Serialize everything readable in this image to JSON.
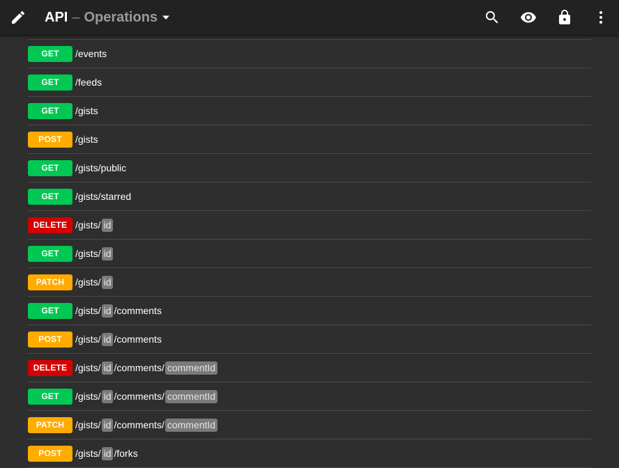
{
  "header": {
    "title_main": "API",
    "title_separator": "–",
    "title_section": "Operations",
    "icons": [
      "edit-icon",
      "search-icon",
      "visibility-icon",
      "lock-icon",
      "more-vert-icon"
    ]
  },
  "colors": {
    "GET": "#00c853",
    "POST": "#ffab00",
    "PATCH": "#ffab00",
    "DELETE": "#d50000"
  },
  "operations": [
    {
      "method": "GET",
      "parts": [
        {
          "t": "text",
          "v": "/"
        }
      ]
    },
    {
      "method": "GET",
      "parts": [
        {
          "t": "text",
          "v": "/events"
        }
      ]
    },
    {
      "method": "GET",
      "parts": [
        {
          "t": "text",
          "v": "/feeds"
        }
      ]
    },
    {
      "method": "GET",
      "parts": [
        {
          "t": "text",
          "v": "/gists"
        }
      ]
    },
    {
      "method": "POST",
      "parts": [
        {
          "t": "text",
          "v": "/gists"
        }
      ]
    },
    {
      "method": "GET",
      "parts": [
        {
          "t": "text",
          "v": "/gists/public"
        }
      ]
    },
    {
      "method": "GET",
      "parts": [
        {
          "t": "text",
          "v": "/gists/starred"
        }
      ]
    },
    {
      "method": "DELETE",
      "parts": [
        {
          "t": "text",
          "v": "/gists/"
        },
        {
          "t": "param",
          "v": "id"
        }
      ]
    },
    {
      "method": "GET",
      "parts": [
        {
          "t": "text",
          "v": "/gists/"
        },
        {
          "t": "param",
          "v": "id"
        }
      ]
    },
    {
      "method": "PATCH",
      "parts": [
        {
          "t": "text",
          "v": "/gists/"
        },
        {
          "t": "param",
          "v": "id"
        }
      ]
    },
    {
      "method": "GET",
      "parts": [
        {
          "t": "text",
          "v": "/gists/"
        },
        {
          "t": "param",
          "v": "id"
        },
        {
          "t": "text",
          "v": "/comments"
        }
      ]
    },
    {
      "method": "POST",
      "parts": [
        {
          "t": "text",
          "v": "/gists/"
        },
        {
          "t": "param",
          "v": "id"
        },
        {
          "t": "text",
          "v": "/comments"
        }
      ]
    },
    {
      "method": "DELETE",
      "parts": [
        {
          "t": "text",
          "v": "/gists/"
        },
        {
          "t": "param",
          "v": "id"
        },
        {
          "t": "text",
          "v": "/comments/"
        },
        {
          "t": "param",
          "v": "commentId"
        }
      ]
    },
    {
      "method": "GET",
      "parts": [
        {
          "t": "text",
          "v": "/gists/"
        },
        {
          "t": "param",
          "v": "id"
        },
        {
          "t": "text",
          "v": "/comments/"
        },
        {
          "t": "param",
          "v": "commentId"
        }
      ]
    },
    {
      "method": "PATCH",
      "parts": [
        {
          "t": "text",
          "v": "/gists/"
        },
        {
          "t": "param",
          "v": "id"
        },
        {
          "t": "text",
          "v": "/comments/"
        },
        {
          "t": "param",
          "v": "commentId"
        }
      ]
    },
    {
      "method": "POST",
      "parts": [
        {
          "t": "text",
          "v": "/gists/"
        },
        {
          "t": "param",
          "v": "id"
        },
        {
          "t": "text",
          "v": "/forks"
        }
      ]
    }
  ]
}
